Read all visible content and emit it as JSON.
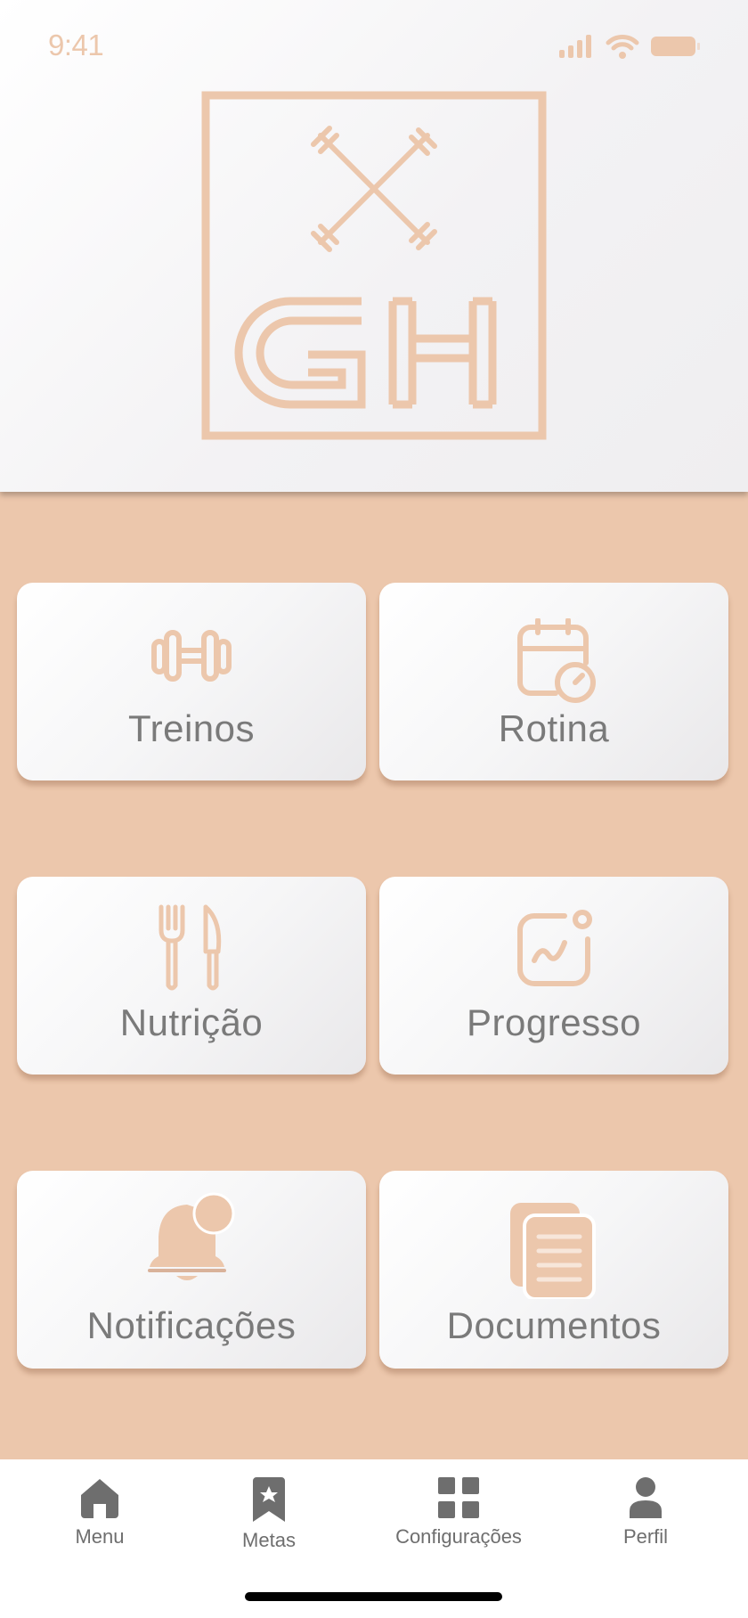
{
  "status_bar": {
    "time": "9:41"
  },
  "logo": {
    "text": "GH"
  },
  "colors": {
    "accent": "#ecc7ac",
    "label": "#7a7a7a",
    "tab_icon": "#6e6e6e"
  },
  "menu": [
    {
      "label": "Treinos",
      "icon": "dumbbell-icon"
    },
    {
      "label": "Rotina",
      "icon": "calendar-clock-icon"
    },
    {
      "label": "Nutrição",
      "icon": "fork-knife-icon"
    },
    {
      "label": "Progresso",
      "icon": "chart-progress-icon"
    },
    {
      "label": "Notificações",
      "icon": "bell-icon"
    },
    {
      "label": "Documentos",
      "icon": "documents-icon"
    }
  ],
  "tabbar": [
    {
      "label": "Menu",
      "icon": "home-icon"
    },
    {
      "label": "Metas",
      "icon": "bookmark-star-icon"
    },
    {
      "label": "Configurações",
      "icon": "grid-icon"
    },
    {
      "label": "Perfil",
      "icon": "person-icon"
    }
  ]
}
